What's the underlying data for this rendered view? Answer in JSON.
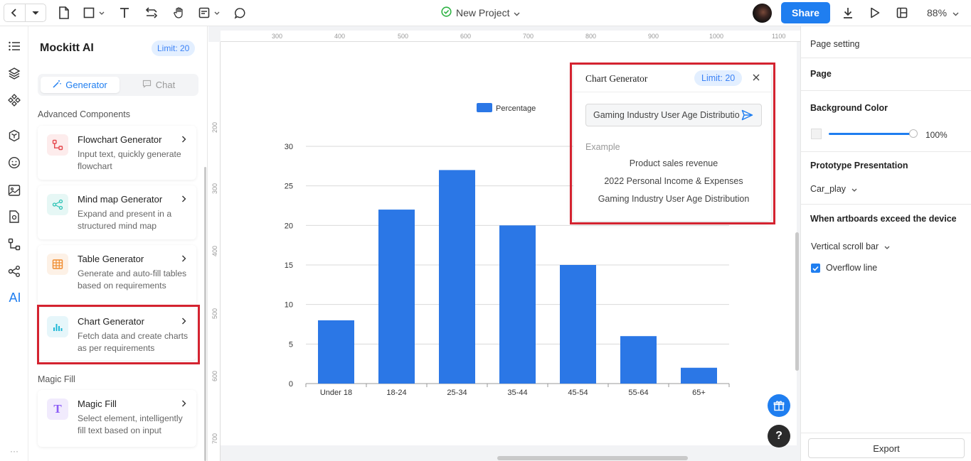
{
  "topbar": {
    "project_title": "New Project",
    "share_label": "Share",
    "zoom_level": "88%"
  },
  "ai_panel": {
    "title": "Mockitt AI",
    "limit_badge": "Limit: 20",
    "tab_generator": "Generator",
    "tab_chat": "Chat",
    "section_advanced": "Advanced Components",
    "section_magic": "Magic Fill",
    "cards": [
      {
        "title": "Flowchart Generator",
        "desc": "Input text, quickly generate flowchart",
        "icon": "flowchart-icon",
        "color": "#e5484d",
        "bg": "#fdecec"
      },
      {
        "title": "Mind map Generator",
        "desc": "Expand and present in a structured mind map",
        "icon": "mindmap-icon",
        "color": "#2cc3b5",
        "bg": "#e6f7f5"
      },
      {
        "title": "Table Generator",
        "desc": "Generate and auto-fill tables based on requirements",
        "icon": "table-icon",
        "color": "#f08c2e",
        "bg": "#fdf1e6"
      },
      {
        "title": "Chart Generator",
        "desc": "Fetch data and create charts as per requirements",
        "icon": "bar-chart-icon",
        "color": "#1fb8d6",
        "bg": "#e6f6fa"
      },
      {
        "title": "Magic Fill",
        "desc": "Select element, intelligently fill text based on input",
        "icon": "magic-text-icon",
        "color": "#8b5cf6",
        "bg": "#f1ebfd"
      }
    ]
  },
  "ruler": {
    "top": [
      "300",
      "400",
      "500",
      "600",
      "700",
      "800",
      "900",
      "1000",
      "1100"
    ],
    "left": [
      "200",
      "300",
      "400",
      "500",
      "600",
      "700"
    ]
  },
  "chart_data": {
    "type": "bar",
    "categories": [
      "Under 18",
      "18-24",
      "25-34",
      "35-44",
      "45-54",
      "55-64",
      "65+"
    ],
    "series": [
      {
        "name": "Percentage",
        "values": [
          8,
          22,
          27,
          20,
          15,
          6,
          2
        ],
        "color": "#2b77e6"
      }
    ],
    "ylim": [
      0,
      30
    ],
    "yticks": [
      0,
      5,
      10,
      15,
      20,
      25,
      30
    ],
    "grid": true,
    "legend": "top-center"
  },
  "chart_popup": {
    "title": "Chart Generator",
    "limit_badge": "Limit: 20",
    "input_value": "Gaming Industry User Age Distributio",
    "example_label": "Example",
    "examples": [
      "Product sales revenue",
      "2022 Personal Income & Expenses",
      "Gaming Industry User Age Distribution"
    ]
  },
  "right_panel": {
    "page_setting": "Page setting",
    "page": "Page",
    "background_color": "Background Color",
    "opacity": "100%",
    "prototype_presentation": "Prototype Presentation",
    "device": "Car_play",
    "exceed_title": "When artboards exceed the device",
    "scroll_option": "Vertical scroll bar",
    "overflow_line": "Overflow line",
    "export_label": "Export"
  },
  "colors": {
    "accent": "#1f7ef0",
    "highlight": "#d42330"
  }
}
